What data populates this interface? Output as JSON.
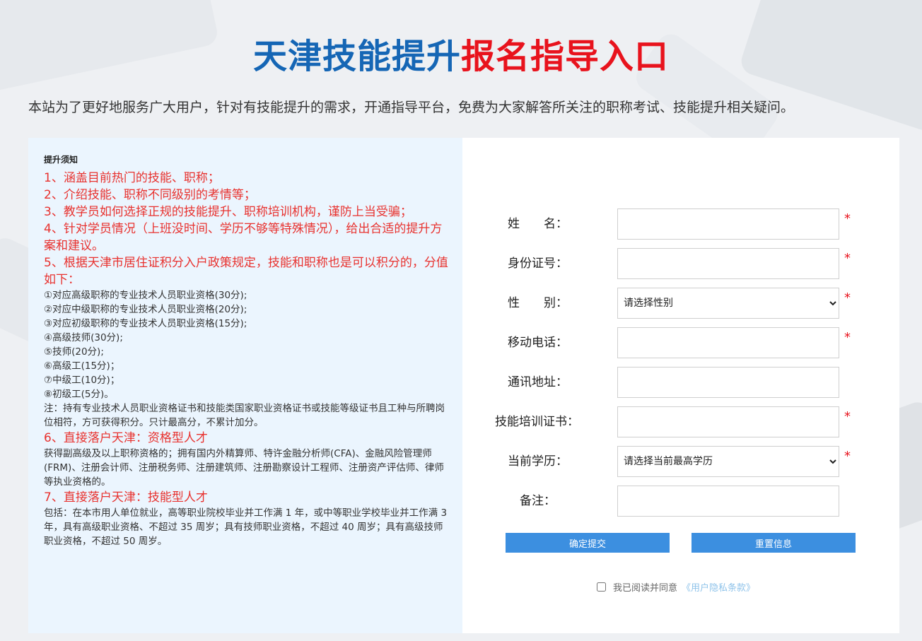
{
  "header": {
    "title_blue": "天津技能提升",
    "title_red": "报名指导入口"
  },
  "intro": "本站为了更好地服务广大用户，针对有技能提升的需求，开通指导平台，免费为大家解答所关注的职称考试、技能提升相关疑问。",
  "notice": {
    "title": "提升须知",
    "items": [
      "1、涵盖目前热门的技能、职称；",
      "2、介绍技能、职称不同级别的考情等；",
      "3、教学员如何选择正规的技能提升、职称培训机构，谨防上当受骗；",
      "4、针对学员情况（上班没时间、学历不够等特殊情况），给出合适的提升方案和建议。",
      "5、根据天津市居住证积分入户政策规定，技能和职称也是可以积分的，分值如下："
    ],
    "scores": [
      "①对应高级职称的专业技术人员职业资格(30分);",
      "②对应中级职称的专业技术人员职业资格(20分);",
      "③对应初级职称的专业技术人员职业资格(15分);",
      "④高级技师(30分);",
      "⑤技师(20分);",
      "⑥高级工(15分)；",
      "⑦中级工(10分)；",
      "⑧初级工(5分)。"
    ],
    "note": "注：持有专业技术人员职业资格证书和技能类国家职业资格证书或技能等级证书且工种与所聘岗位相符，方可获得积分。只计最高分，不累计加分。",
    "item6_title": "6、直接落户天津：资格型人才",
    "item6_text": "获得副高级及以上职称资格的；拥有国内外精算师、特许金融分析师(CFA)、金融风险管理师(FRM)、注册会计师、注册税务师、注册建筑师、注册勘察设计工程师、注册资产评估师、律师等执业资格的。",
    "item7_title": "7、直接落户天津：技能型人才",
    "item7_text": "包括：在本市用人单位就业，高等职业院校毕业并工作满 1 年，或中等职业学校毕业并工作满 3 年，具有高级职业资格、不超过 35 周岁；具有技师职业资格，不超过 40 周岁；具有高级技师职业资格，不超过 50 周岁。"
  },
  "form": {
    "name_label": "姓　　名：",
    "id_label": "身份证号：",
    "gender_label": "性　　别：",
    "gender_option": "请选择性别",
    "phone_label": "移动电话：",
    "address_label": "通讯地址：",
    "cert_label": "技能培训证书：",
    "edu_label": "当前学历：",
    "edu_option": "请选择当前最高学历",
    "remark_label": "备注：",
    "required_mark": "*",
    "submit_label": "确定提交",
    "reset_label": "重置信息",
    "agree_text": "我已阅读并同意",
    "agree_link": "《用户隐私条款》"
  }
}
